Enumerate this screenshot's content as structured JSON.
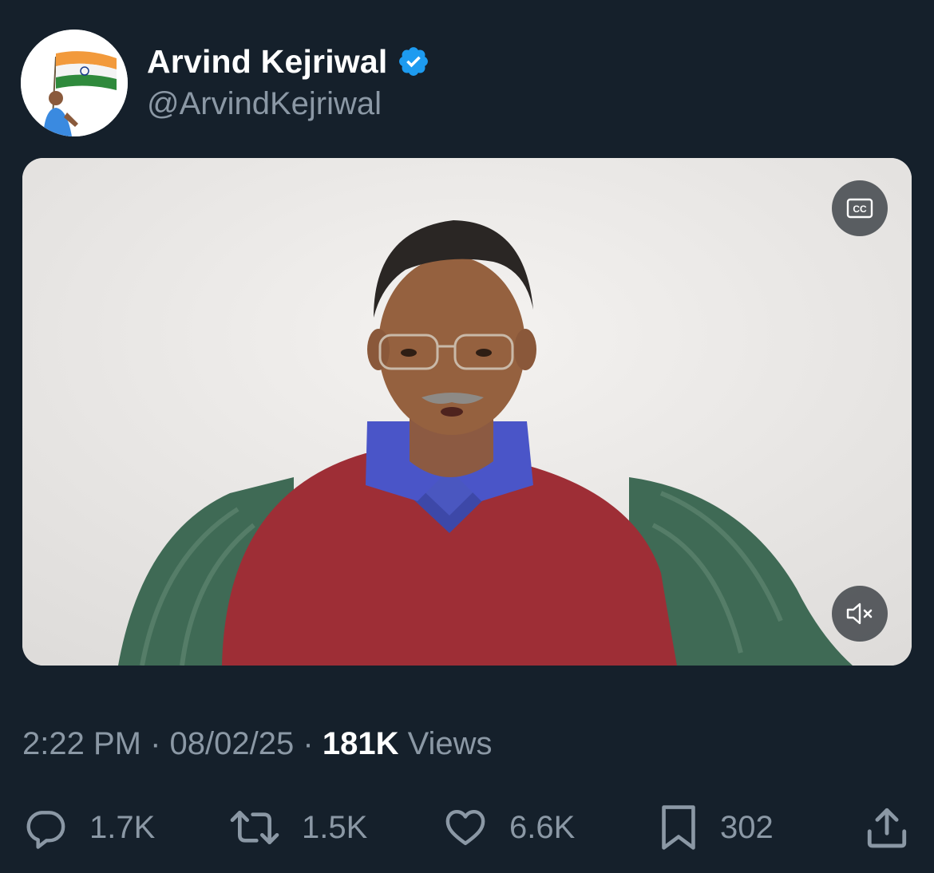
{
  "author": {
    "display_name": "Arvind Kejriwal",
    "handle": "@ArvindKejriwal",
    "verified_icon": "verified-badge-icon"
  },
  "video": {
    "cc_icon": "closed-captions-icon",
    "mute_icon": "speaker-muted-icon"
  },
  "meta": {
    "time": "2:22 PM",
    "separator": "·",
    "date": "08/02/25",
    "views_count": "181K",
    "views_label": "Views"
  },
  "actions": {
    "replies": "1.7K",
    "reposts": "1.5K",
    "likes": "6.6K",
    "bookmarks": "302"
  },
  "colors": {
    "background": "#15202b",
    "verified": "#1d9bf0",
    "secondary_text": "#8b98a5"
  }
}
